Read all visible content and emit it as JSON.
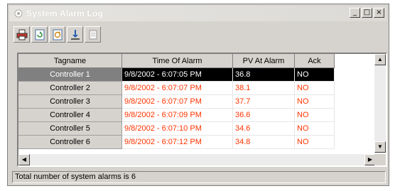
{
  "window": {
    "title": "System Alarm Log"
  },
  "titlebar_buttons": {
    "minimize": "_",
    "maximize": "□",
    "close": "×"
  },
  "toolbar": {
    "buttons": [
      "print-icon",
      "refresh-icon",
      "refresh-all-icon",
      "download-icon",
      "export-icon"
    ]
  },
  "grid": {
    "columns": [
      "Tagname",
      "Time Of Alarm",
      "PV At Alarm",
      "Ack"
    ],
    "rows": [
      {
        "tagname": "Controller 1",
        "time": "9/8/2002 - 6:07:05 PM",
        "pv": "36.8",
        "ack": "NO"
      },
      {
        "tagname": "Controller 2",
        "time": "9/8/2002 - 6:07:07 PM",
        "pv": "38.1",
        "ack": "NO"
      },
      {
        "tagname": "Controller 3",
        "time": "9/8/2002 - 6:07:07 PM",
        "pv": "37.7",
        "ack": "NO"
      },
      {
        "tagname": "Controller 4",
        "time": "9/8/2002 - 6:07:09 PM",
        "pv": "36.6",
        "ack": "NO"
      },
      {
        "tagname": "Controller 5",
        "time": "9/8/2002 - 6:07:10 PM",
        "pv": "34.6",
        "ack": "NO"
      },
      {
        "tagname": "Controller 6",
        "time": "9/8/2002 - 6:07:12 PM",
        "pv": "34.8",
        "ack": "NO"
      }
    ],
    "selected_row": 0
  },
  "colors": {
    "alarm_text": "#ff3300",
    "selected_bg": "#000000",
    "window_bg": "#d6d3ce"
  },
  "status": {
    "text": "Total number of system alarms is 6"
  }
}
